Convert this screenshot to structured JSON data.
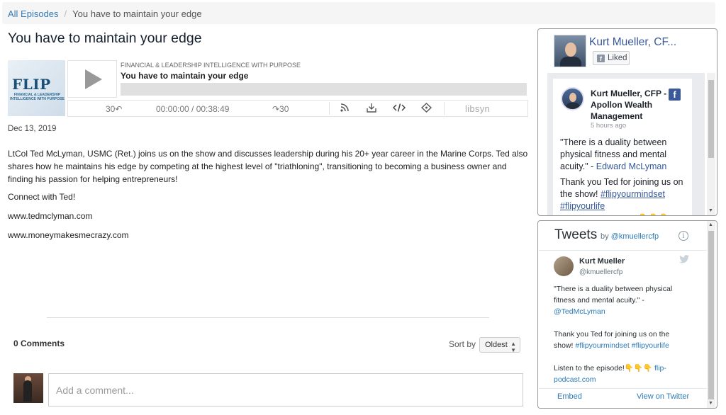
{
  "breadcrumb": {
    "all_episodes": "All Episodes",
    "separator": "/",
    "current": "You have to maintain your edge"
  },
  "page_title": "You have to maintain your edge",
  "player": {
    "cover_logo": "FLIP",
    "cover_subtitle": "FINANCIAL & LEADERSHIP INTELLIGENCE WITH PURPOSE",
    "show_name": "FINANCIAL & LEADERSHIP INTELLIGENCE WITH PURPOSE",
    "episode_title": "You have to maintain your edge",
    "rewind_label": "30↶",
    "time": "00:00:00 / 00:38:49",
    "forward_label": "↷30",
    "brand": "libsyn",
    "progress": 0
  },
  "episode": {
    "date": "Dec 13, 2019",
    "description": "LtCol Ted McLyman, USMC (Ret.) joins us on the show and discusses leadership during his 20+ year career in the Marine Corps.  Ted also shares how he maintains his edge by competing at the highest level of \"triathloning\", transitioning to becoming a business owner and finding his passion for helping entrepreneurs!",
    "connect": "Connect with Ted!",
    "link1": "www.tedmclyman.com",
    "link2": "www.moneymakesmecrazy.com"
  },
  "comments": {
    "count": "0 Comments",
    "sort_label": "Sort by",
    "sort_value": "Oldest",
    "placeholder": "Add a comment..."
  },
  "facebook": {
    "page_name": "Kurt Mueller, CF...",
    "liked": "Liked",
    "post_author": "Kurt Mueller, CFP - Apollon Wealth Management",
    "post_time": "5 hours ago",
    "post_text1_a": "\"There is a duality between physical fitness and mental acuity.\" - ",
    "post_text1_link": "Edward McLyman",
    "post_text2_a": "Thank you Ted for joining us on the show! ",
    "post_tag1": "#flipyourmindset",
    "post_tag2": "#flipyourlife",
    "post_partial": "👇👇👇"
  },
  "twitter": {
    "title": "Tweets",
    "by": "by",
    "by_handle": "@kmuellercfp",
    "info": "i",
    "name": "Kurt Mueller",
    "handle": "@kmuellercfp",
    "tweet_p1_a": "\"There is a duality between physical fitness and mental acuity.\" - ",
    "tweet_p1_link": "@TedMcLyman",
    "tweet_p2_a": "Thank you Ted for joining us on the show! ",
    "tweet_p2_tags": "#flipyourmindset #flipyourlife",
    "tweet_p3_a": "Listen to the episode!👇👇👇 ",
    "tweet_p3_link": "flip-podcast.com",
    "embed": "Embed",
    "view_on_twitter": "View on Twitter"
  },
  "colors": {
    "link_blue": "#337ab7",
    "facebook_blue": "#3b5998",
    "twitter_blue": "#2b7bb9"
  }
}
